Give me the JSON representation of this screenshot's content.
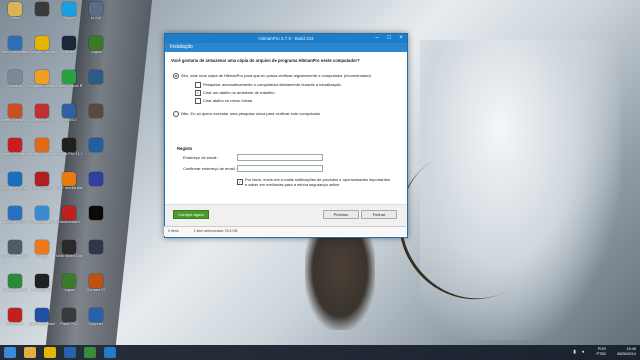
{
  "desktop_icons": [
    {
      "label": "Feira",
      "color": "#d9b35a"
    },
    {
      "label": "",
      "color": "#3a3a3a"
    },
    {
      "label": "Skype",
      "color": "#1aa0e0"
    },
    {
      "label": "N-StZ",
      "color": "#5a6c86"
    },
    {
      "label": "Meu computador",
      "color": "#2f6fb5"
    },
    {
      "label": "Google Chrome",
      "color": "#e6b400"
    },
    {
      "label": "Steam",
      "color": "#1b2838"
    },
    {
      "label": "Jogos",
      "color": "#3a7a2a"
    },
    {
      "label": "Lixeira",
      "color": "#7a8a9a"
    },
    {
      "label": "LogMeIn Hamachi",
      "color": "#f0a020"
    },
    {
      "label": "Razer Game Booster",
      "color": "#2aa040"
    },
    {
      "label": "",
      "color": "#2c5a8a"
    },
    {
      "label": "Ares Translator",
      "color": "#c85020"
    },
    {
      "label": "Megacubo",
      "color": "#c03030"
    },
    {
      "label": "UltraISO",
      "color": "#3060a0"
    },
    {
      "label": "",
      "color": "#5a4a3a"
    },
    {
      "label": "Adobe Reader XI",
      "color": "#c81e1e"
    },
    {
      "label": "Mozilla Firefox",
      "color": "#e06a18"
    },
    {
      "label": "Vegas Pro 11.0 (64-bit)",
      "color": "#202020"
    },
    {
      "label": "",
      "color": "#2060a0"
    },
    {
      "label": "Advanced SystemCare 7",
      "color": "#1a6ec0"
    },
    {
      "label": "Nero 2014",
      "color": "#b02020"
    },
    {
      "label": "VLC media player",
      "color": "#e87a10"
    },
    {
      "label": "",
      "color": "#3040a0"
    },
    {
      "label": "Alcohol 120%",
      "color": "#2a70c0"
    },
    {
      "label": "Wondershare Video Converter",
      "color": "#3a8ad0"
    },
    {
      "label": "Wondershare Video Editor",
      "color": "#c02020"
    },
    {
      "label": "",
      "color": "#0a0a0a"
    },
    {
      "label": "Orvell Interactive",
      "color": "#505a64"
    },
    {
      "label": "Origin",
      "color": "#f07818"
    },
    {
      "label": "Vidz Video Downloader",
      "color": "#2a2a2a"
    },
    {
      "label": "",
      "color": "#303848"
    },
    {
      "label": "Camtasia Studio 8",
      "color": "#2a8a3a"
    },
    {
      "label": "PerfectDisk",
      "color": "#202020"
    },
    {
      "label": "Jogos",
      "color": "#3a7a2a"
    },
    {
      "label": "Contact 07",
      "color": "#c05010"
    },
    {
      "label": "CCleaner",
      "color": "#c02020"
    },
    {
      "label": "Revo Uninstaller",
      "color": "#2050a0"
    },
    {
      "label": "Pack PS2",
      "color": "#3a3a3a"
    },
    {
      "label": "Dolphin",
      "color": "#2a60b0"
    }
  ],
  "window": {
    "title": "HitmanPro 3.7.9 - Build 224",
    "header": "Instalação",
    "question": "Você gostaria de armazenar uma cópia do arquivo de programa HitmanPro neste computador?",
    "option_yes": "Sim, criar uma cópia de HitmanPro para que eu possa verificar regularmente o computador (recomendado)",
    "sub_options": [
      {
        "label": "Pesquisar automaticamente o computador diariamente durante a inicialização",
        "checked": false
      },
      {
        "label": "Criar um atalho no ambiente de trabalho",
        "checked": true
      },
      {
        "label": "Criar atalho no menu Iniciar",
        "checked": false
      }
    ],
    "option_no": "Não, Eu só quero executar uma pesquisa única para verificar este computador",
    "registration_title": "Registo",
    "email_label": "Endereço de email :",
    "email_confirm_label": "Confirmar endereço de email :",
    "email_value": "",
    "email_confirm_value": "",
    "newsletter": "Por favor, envie-me e-mails notificações de produtos e oportunidades importantes e saber em melhorias para a minha segurança online",
    "newsletter_checked": true,
    "buy_button": "Compre agora",
    "next_button": "Próximo",
    "close_button": "Fechar"
  },
  "status_bar": {
    "items": "0 itens",
    "selected": "1 item selecionado 78,4 KB"
  },
  "taskbar": {
    "apps": [
      {
        "name": "windows-logo",
        "color": "#3a8ad8"
      },
      {
        "name": "file-explorer",
        "color": "#e0b040"
      },
      {
        "name": "chrome",
        "color": "#e6b400"
      },
      {
        "name": "word",
        "color": "#2b5fb0"
      },
      {
        "name": "camtasia",
        "color": "#3a8a3a"
      },
      {
        "name": "hitmanpro",
        "color": "#1e7dc8"
      }
    ],
    "lang": "POR",
    "layout": "PTB2",
    "time": "15:46",
    "date": "06/06/2014"
  },
  "colors": {
    "titlebar": "#1e7dc8",
    "primary_button": "#4c9a2a"
  }
}
